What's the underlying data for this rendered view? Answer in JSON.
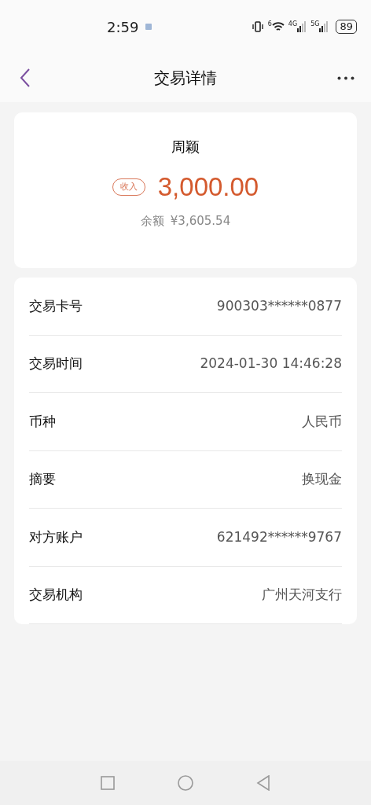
{
  "status_bar": {
    "time": "2:59",
    "wifi_label": "6",
    "net_labels": [
      "4G",
      "5G"
    ],
    "battery": "89"
  },
  "header": {
    "title": "交易详情"
  },
  "summary": {
    "name": "周颖",
    "tag": "收入",
    "amount": "3,000.00",
    "balance_label": "余额",
    "balance": "¥3,605.54"
  },
  "details": [
    {
      "label": "交易卡号",
      "value": "900303******0877"
    },
    {
      "label": "交易时间",
      "value": "2024-01-30 14:46:28"
    },
    {
      "label": "币种",
      "value": "人民币"
    },
    {
      "label": "摘要",
      "value": "换现金"
    },
    {
      "label": "对方账户",
      "value": "621492******9767"
    },
    {
      "label": "交易机构",
      "value": "广州天河支行"
    }
  ]
}
